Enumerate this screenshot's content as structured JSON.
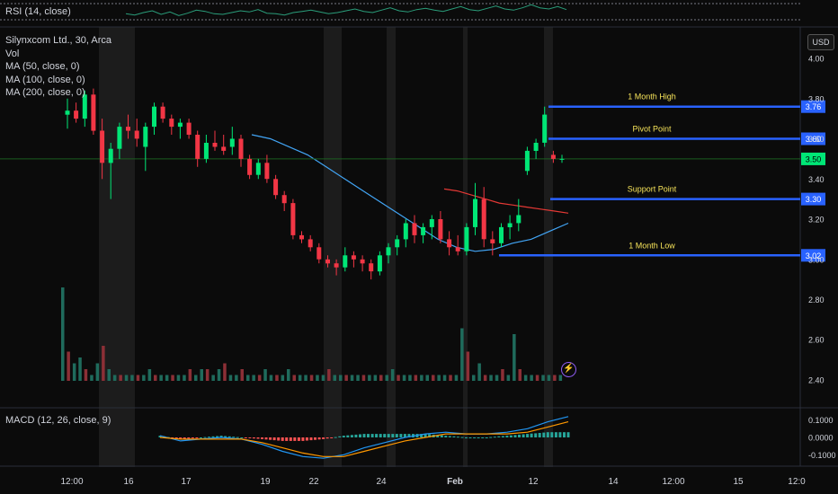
{
  "rsi": {
    "label": "RSI (14, close)"
  },
  "legend": {
    "symbol": "Silynxcom Ltd., 30, Arca",
    "vol": "Vol",
    "ma50": "MA (50, close, 0)",
    "ma100": "MA (100, close, 0)",
    "ma200": "MA (200, close, 0)"
  },
  "macd": {
    "label": "MACD (12, 26, close, 9)"
  },
  "currency": "USD",
  "colors": {
    "up": "#22ab94",
    "upBright": "#00e676",
    "down": "#f23645",
    "level": "#2962ff",
    "levelLabel": "#f7e45a",
    "ma100": "#e53935",
    "ma200": "#42a5f5",
    "signal": "#ff9800",
    "macd": "#2196f3"
  },
  "chart_data": [
    {
      "type": "candlestick",
      "title": "Silynxcom Ltd., 30, Arca",
      "ylim": [
        2.4,
        4.1
      ],
      "price_ticks": [
        "4.00",
        "3.80",
        "3.60",
        "3.40",
        "3.20",
        "3.00",
        "2.80",
        "2.60",
        "2.40"
      ],
      "x_ticks": [
        "12:00",
        "16",
        "17",
        "19",
        "22",
        "24",
        "Feb",
        "12",
        "14",
        "12:00",
        "15",
        "12:0"
      ],
      "current_price": "3.50",
      "levels": [
        {
          "name": "1 Month High",
          "value": 3.76,
          "label": "3.76"
        },
        {
          "name": "Pivot Point",
          "value": 3.6,
          "label": "3.60"
        },
        {
          "name": "Support Point",
          "value": 3.3,
          "label": "3.30"
        },
        {
          "name": "1 Month Low",
          "value": 3.02,
          "label": "3.02"
        }
      ],
      "candles": [
        [
          3.72,
          3.8,
          3.65,
          3.74
        ],
        [
          3.74,
          3.78,
          3.68,
          3.7
        ],
        [
          3.7,
          3.84,
          3.66,
          3.82
        ],
        [
          3.82,
          3.85,
          3.62,
          3.64
        ],
        [
          3.64,
          3.7,
          3.4,
          3.48
        ],
        [
          3.48,
          3.58,
          3.3,
          3.55
        ],
        [
          3.55,
          3.68,
          3.5,
          3.66
        ],
        [
          3.66,
          3.72,
          3.6,
          3.64
        ],
        [
          3.64,
          3.7,
          3.56,
          3.6
        ],
        [
          3.56,
          3.68,
          3.44,
          3.66
        ],
        [
          3.66,
          3.78,
          3.62,
          3.76
        ],
        [
          3.76,
          3.78,
          3.68,
          3.7
        ],
        [
          3.7,
          3.72,
          3.62,
          3.66
        ],
        [
          3.66,
          3.7,
          3.6,
          3.68
        ],
        [
          3.68,
          3.7,
          3.6,
          3.62
        ],
        [
          3.62,
          3.64,
          3.46,
          3.5
        ],
        [
          3.5,
          3.62,
          3.48,
          3.58
        ],
        [
          3.58,
          3.64,
          3.54,
          3.56
        ],
        [
          3.56,
          3.62,
          3.52,
          3.54
        ],
        [
          3.56,
          3.66,
          3.52,
          3.6
        ],
        [
          3.6,
          3.62,
          3.46,
          3.5
        ],
        [
          3.5,
          3.52,
          3.4,
          3.42
        ],
        [
          3.42,
          3.5,
          3.4,
          3.48
        ],
        [
          3.48,
          3.52,
          3.38,
          3.4
        ],
        [
          3.4,
          3.42,
          3.3,
          3.32
        ],
        [
          3.32,
          3.34,
          3.24,
          3.28
        ],
        [
          3.28,
          3.3,
          3.1,
          3.12
        ],
        [
          3.12,
          3.14,
          3.08,
          3.1
        ],
        [
          3.1,
          3.12,
          3.04,
          3.06
        ],
        [
          3.06,
          3.08,
          2.98,
          3.0
        ],
        [
          3.0,
          3.02,
          2.96,
          2.98
        ],
        [
          2.98,
          3.0,
          2.92,
          2.96
        ],
        [
          2.96,
          3.06,
          2.94,
          3.02
        ],
        [
          3.02,
          3.04,
          2.96,
          3.0
        ],
        [
          3.0,
          3.02,
          2.94,
          2.98
        ],
        [
          2.98,
          3.0,
          2.9,
          2.94
        ],
        [
          2.94,
          3.04,
          2.92,
          3.02
        ],
        [
          3.02,
          3.08,
          2.98,
          3.06
        ],
        [
          3.06,
          3.12,
          3.02,
          3.1
        ],
        [
          3.1,
          3.2,
          3.06,
          3.18
        ],
        [
          3.18,
          3.22,
          3.08,
          3.12
        ],
        [
          3.12,
          3.18,
          3.08,
          3.16
        ],
        [
          3.16,
          3.22,
          3.1,
          3.2
        ],
        [
          3.2,
          3.24,
          3.08,
          3.1
        ],
        [
          3.1,
          3.14,
          3.02,
          3.06
        ],
        [
          3.06,
          3.12,
          3.02,
          3.04
        ],
        [
          3.04,
          3.18,
          3.02,
          3.16
        ],
        [
          3.16,
          3.38,
          3.12,
          3.3
        ],
        [
          3.3,
          3.36,
          3.06,
          3.1
        ],
        [
          3.1,
          3.14,
          3.02,
          3.08
        ],
        [
          3.08,
          3.18,
          3.06,
          3.16
        ],
        [
          3.16,
          3.22,
          3.1,
          3.18
        ],
        [
          3.18,
          3.3,
          3.14,
          3.22
        ],
        [
          3.44,
          3.56,
          3.42,
          3.54
        ],
        [
          3.54,
          3.6,
          3.5,
          3.58
        ],
        [
          3.58,
          3.76,
          3.56,
          3.72
        ],
        [
          3.52,
          3.54,
          3.48,
          3.5
        ],
        [
          3.5,
          3.52,
          3.48,
          3.5
        ]
      ],
      "ma100": [
        [
          3.36,
          3.35
        ],
        [
          3.38,
          3.34
        ],
        [
          3.4,
          3.32
        ],
        [
          3.42,
          3.3
        ],
        [
          3.44,
          3.28
        ],
        [
          3.46,
          3.27
        ],
        [
          3.48,
          3.26
        ],
        [
          3.5,
          3.25
        ],
        [
          3.52,
          3.24
        ],
        [
          3.54,
          3.23
        ]
      ],
      "ma200": [
        [
          3.62,
          3.62
        ],
        [
          3.64,
          3.6
        ],
        [
          3.66,
          3.56
        ],
        [
          3.68,
          3.52
        ],
        [
          3.7,
          3.46
        ],
        [
          3.72,
          3.4
        ],
        [
          3.74,
          3.34
        ],
        [
          3.76,
          3.28
        ],
        [
          3.78,
          3.22
        ],
        [
          3.8,
          3.16
        ],
        [
          3.82,
          3.1
        ],
        [
          3.84,
          3.06
        ],
        [
          3.86,
          3.04
        ],
        [
          3.88,
          3.05
        ],
        [
          3.9,
          3.08
        ],
        [
          3.92,
          3.1
        ],
        [
          3.94,
          3.14
        ],
        [
          3.96,
          3.18
        ]
      ]
    },
    {
      "type": "bar",
      "title": "Vol",
      "values": [
        16,
        5,
        3,
        4,
        2,
        1,
        3,
        6,
        2,
        1,
        1,
        1,
        1,
        1,
        1,
        2,
        1,
        1,
        1,
        1,
        1,
        1,
        2,
        1,
        2,
        2,
        1,
        2,
        3,
        1,
        1,
        2,
        1,
        1,
        1,
        2,
        1,
        1,
        1,
        2,
        1,
        1,
        1,
        1,
        1,
        1,
        2,
        1,
        1,
        1,
        1,
        1,
        1,
        1,
        1,
        1,
        1,
        2,
        1,
        1,
        1,
        1,
        1,
        1,
        1,
        1,
        1,
        1,
        1,
        9,
        5,
        1,
        3,
        1,
        1,
        1,
        2,
        1,
        8,
        2,
        1,
        1,
        1,
        1,
        1,
        1,
        1
      ]
    },
    {
      "type": "line",
      "title": "MACD (12, 26, close, 9)",
      "ylim": [
        -0.15,
        0.15
      ],
      "y_ticks": [
        "0.1000",
        "0.0000",
        "-0.1000"
      ],
      "series": [
        {
          "name": "MACD",
          "x": [
            0,
            5,
            10,
            15,
            20,
            25,
            30,
            35,
            40,
            45,
            50,
            55,
            60,
            65,
            70,
            75,
            80,
            85,
            90,
            95,
            100
          ],
          "values": [
            0.01,
            -0.02,
            -0.01,
            0.0,
            -0.01,
            -0.04,
            -0.08,
            -0.11,
            -0.12,
            -0.1,
            -0.06,
            -0.03,
            0.0,
            0.02,
            0.03,
            0.02,
            0.02,
            0.03,
            0.05,
            0.09,
            0.12
          ]
        },
        {
          "name": "Signal",
          "x": [
            0,
            5,
            10,
            15,
            20,
            25,
            30,
            35,
            40,
            45,
            50,
            55,
            60,
            65,
            70,
            75,
            80,
            85,
            90,
            95,
            100
          ],
          "values": [
            0.0,
            -0.01,
            -0.01,
            -0.01,
            -0.01,
            -0.03,
            -0.06,
            -0.09,
            -0.11,
            -0.11,
            -0.08,
            -0.05,
            -0.02,
            0.0,
            0.02,
            0.02,
            0.02,
            0.02,
            0.03,
            0.06,
            0.09
          ]
        }
      ]
    },
    {
      "type": "line",
      "title": "RSI (14, close)",
      "values": [
        50,
        48,
        52,
        55,
        49,
        53,
        47,
        51,
        56,
        54,
        50,
        49,
        52,
        55,
        53,
        57,
        51,
        50,
        48,
        52,
        54,
        56,
        53,
        50,
        52,
        55,
        58,
        54,
        52,
        56,
        60,
        55,
        53,
        57,
        59,
        56,
        54,
        58,
        62,
        57,
        55,
        59,
        63,
        58,
        56,
        60,
        65,
        60,
        58,
        62,
        57
      ]
    }
  ]
}
